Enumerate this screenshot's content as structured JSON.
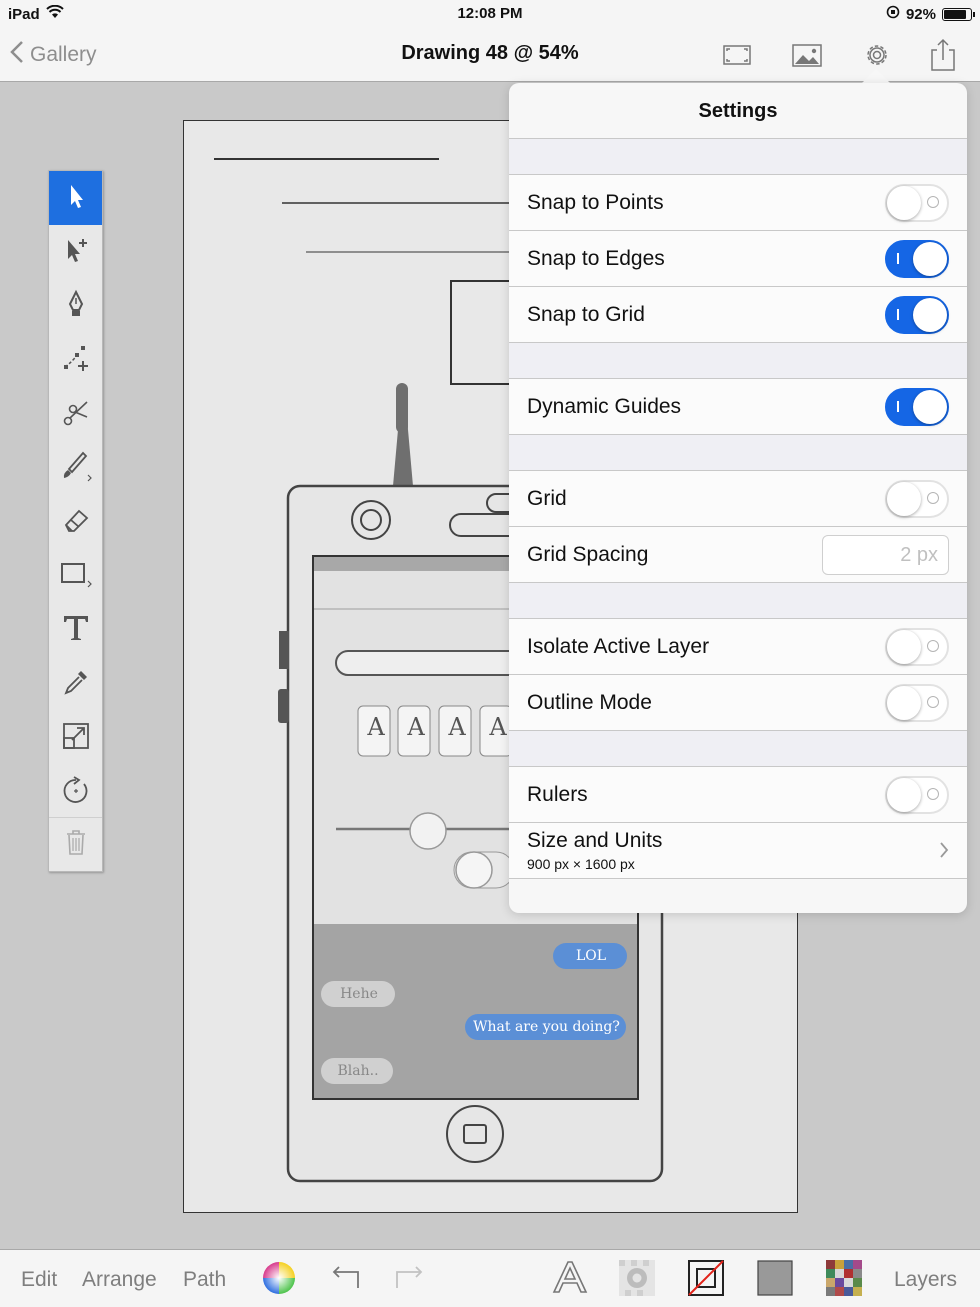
{
  "status_bar": {
    "device": "iPad",
    "time": "12:08 PM",
    "battery": "92%",
    "battery_level": 0.92
  },
  "nav": {
    "back_label": "Gallery",
    "title": "Drawing 48 @ 54%"
  },
  "settings": {
    "title": "Settings",
    "snap_to_points": {
      "label": "Snap to Points",
      "on": false
    },
    "snap_to_edges": {
      "label": "Snap to Edges",
      "on": true
    },
    "snap_to_grid": {
      "label": "Snap to Grid",
      "on": true
    },
    "dynamic_guides": {
      "label": "Dynamic Guides",
      "on": true
    },
    "grid": {
      "label": "Grid",
      "on": false
    },
    "grid_spacing": {
      "label": "Grid Spacing",
      "placeholder": "2 px"
    },
    "isolate_active_layer": {
      "label": "Isolate Active Layer",
      "on": false
    },
    "outline_mode": {
      "label": "Outline Mode",
      "on": false
    },
    "rulers": {
      "label": "Rulers",
      "on": false
    },
    "size_and_units": {
      "label": "Size and Units",
      "value": "900 px × 1600 px"
    }
  },
  "artboard": {
    "letters": [
      "A",
      "A",
      "A",
      "A"
    ],
    "chat": {
      "lol": "LOL",
      "hehe": "Hehe",
      "question": "What are you doing?",
      "blah": "Blah.."
    }
  },
  "bottom_bar": {
    "edit": "Edit",
    "arrange": "Arrange",
    "path": "Path",
    "layers": "Layers"
  },
  "colors": {
    "accent": "#1566e5",
    "tool_active": "#1e6fe0",
    "chat_blue": "#5b8fd6"
  }
}
